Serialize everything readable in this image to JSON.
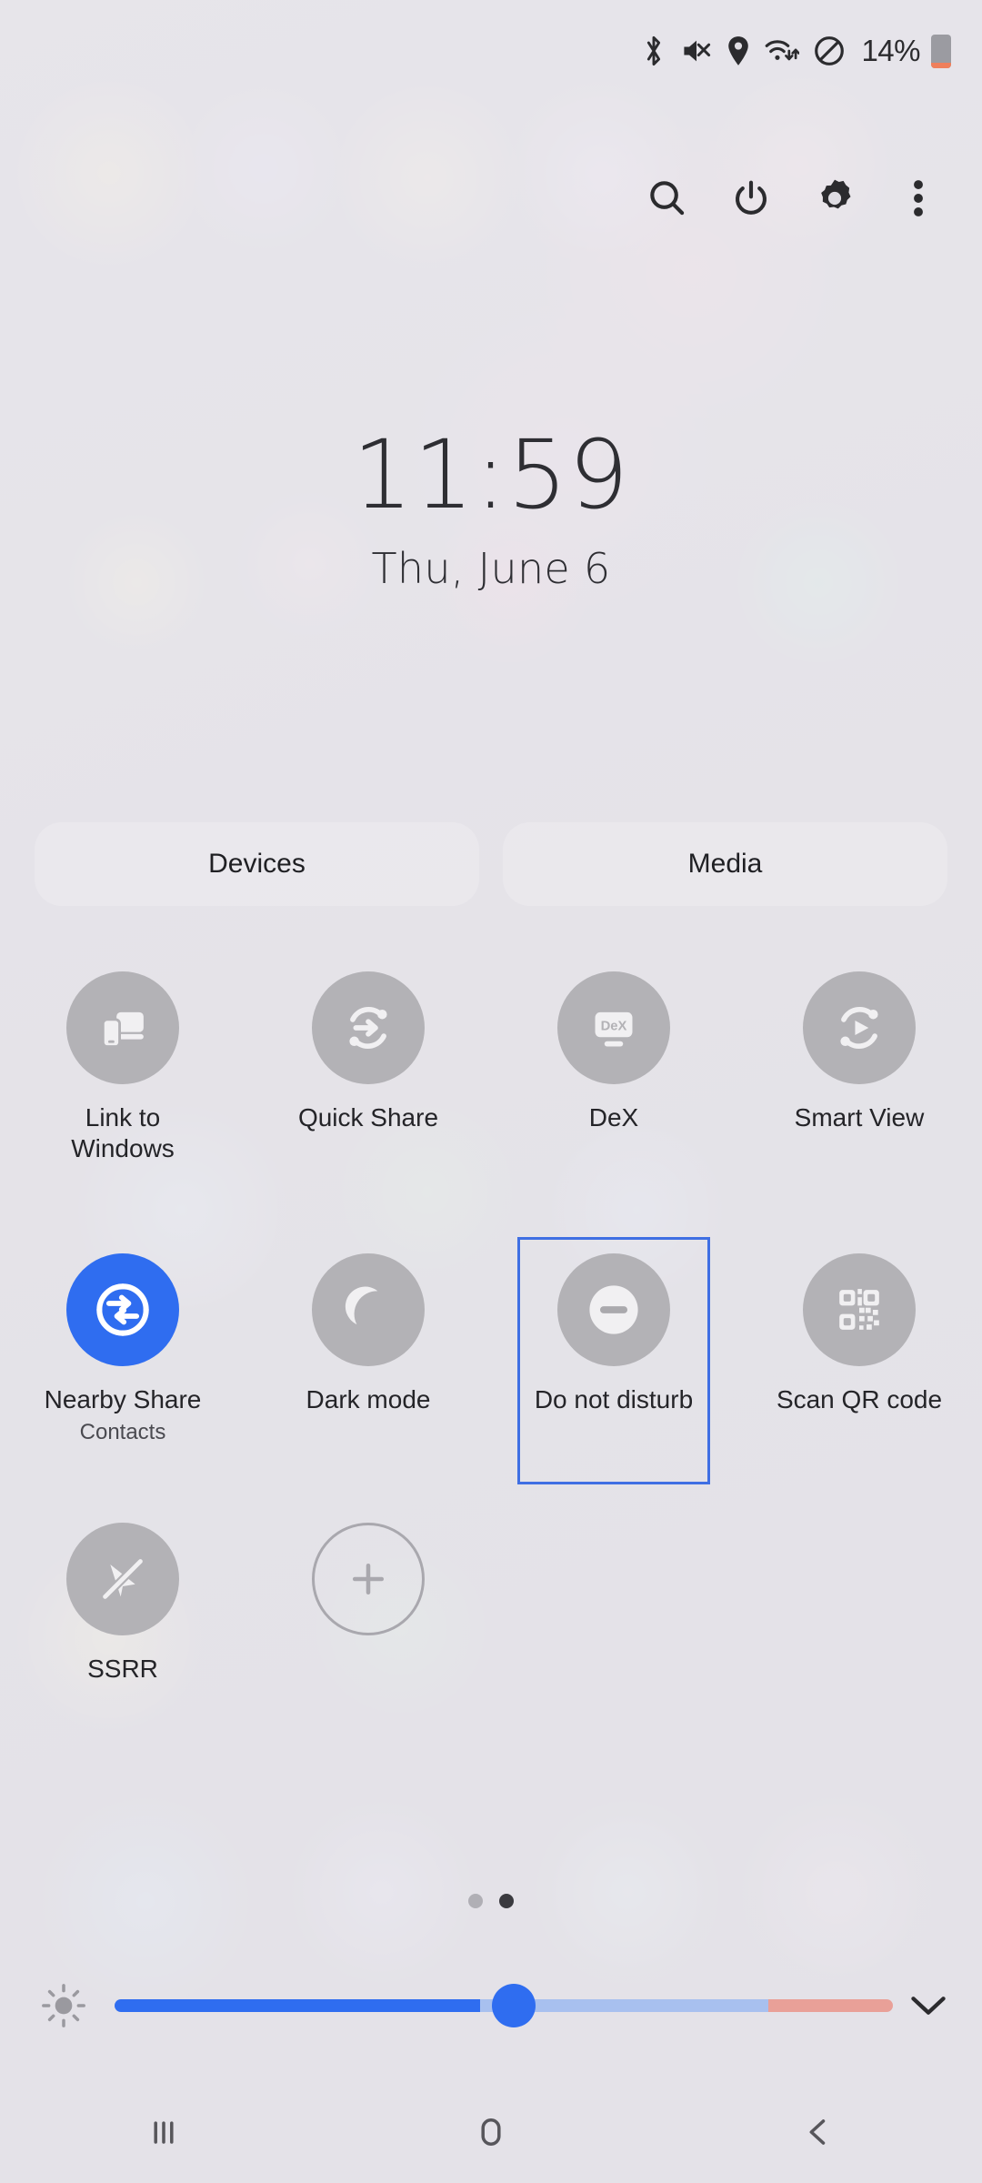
{
  "status_bar": {
    "icons": [
      "bluetooth-icon",
      "sound-muted-icon",
      "location-icon",
      "wifi-icon",
      "do-not-disturb-icon"
    ],
    "battery_percent": "14%",
    "battery_level": 14
  },
  "toolbar": {
    "buttons": [
      {
        "name": "search-button",
        "icon": "search-icon"
      },
      {
        "name": "power-button",
        "icon": "power-icon"
      },
      {
        "name": "settings-button",
        "icon": "gear-icon"
      },
      {
        "name": "more-options-button",
        "icon": "three-dots-icon"
      }
    ]
  },
  "clock": {
    "time": "11:59",
    "date": "Thu, June 6"
  },
  "pills": [
    {
      "name": "devices-pill",
      "label": "Devices"
    },
    {
      "name": "media-pill",
      "label": "Media"
    }
  ],
  "tiles": [
    {
      "name": "link-to-windows",
      "label": "Link to Windows",
      "icon": "phone-monitor-icon",
      "active": false,
      "sublabel": ""
    },
    {
      "name": "quick-share",
      "label": "Quick Share",
      "icon": "quick-share-icon",
      "active": false,
      "sublabel": ""
    },
    {
      "name": "dex",
      "label": "DeX",
      "icon": "dex-monitor-icon",
      "active": false,
      "sublabel": "",
      "icon_text": "DeX"
    },
    {
      "name": "smart-view",
      "label": "Smart View",
      "icon": "smart-view-icon",
      "active": false,
      "sublabel": ""
    },
    {
      "name": "nearby-share",
      "label": "Nearby Share",
      "icon": "nearby-share-icon",
      "active": true,
      "sublabel": "Contacts"
    },
    {
      "name": "dark-mode",
      "label": "Dark mode",
      "icon": "moon-icon",
      "active": false,
      "sublabel": ""
    },
    {
      "name": "do-not-disturb",
      "label": "Do not disturb",
      "icon": "minus-circle-icon",
      "active": false,
      "sublabel": "",
      "selected": true
    },
    {
      "name": "scan-qr-code",
      "label": "Scan QR code",
      "icon": "qr-code-icon",
      "active": false,
      "sublabel": ""
    },
    {
      "name": "ssrr",
      "label": "SSRR",
      "icon": "signal-slash-icon",
      "active": false,
      "sublabel": ""
    },
    {
      "name": "add-tile",
      "label": "",
      "icon": "plus-icon",
      "active": false,
      "sublabel": ""
    }
  ],
  "pagination": {
    "total": 2,
    "current": 2
  },
  "brightness": {
    "icon": "brightness-icon",
    "value_percent": 47,
    "expand_icon": "chevron-down-icon"
  },
  "nav_bar": [
    {
      "name": "recents-button",
      "icon": "recents-icon"
    },
    {
      "name": "home-button",
      "icon": "home-icon"
    },
    {
      "name": "back-button",
      "icon": "back-icon"
    }
  ],
  "colors": {
    "accent_blue": "#2f6df0",
    "selection_border": "#3f6fe3",
    "tile_bg": "#b3b2b6",
    "battery_low": "#ef7f5c",
    "panel_bg": "#dfdde3"
  }
}
